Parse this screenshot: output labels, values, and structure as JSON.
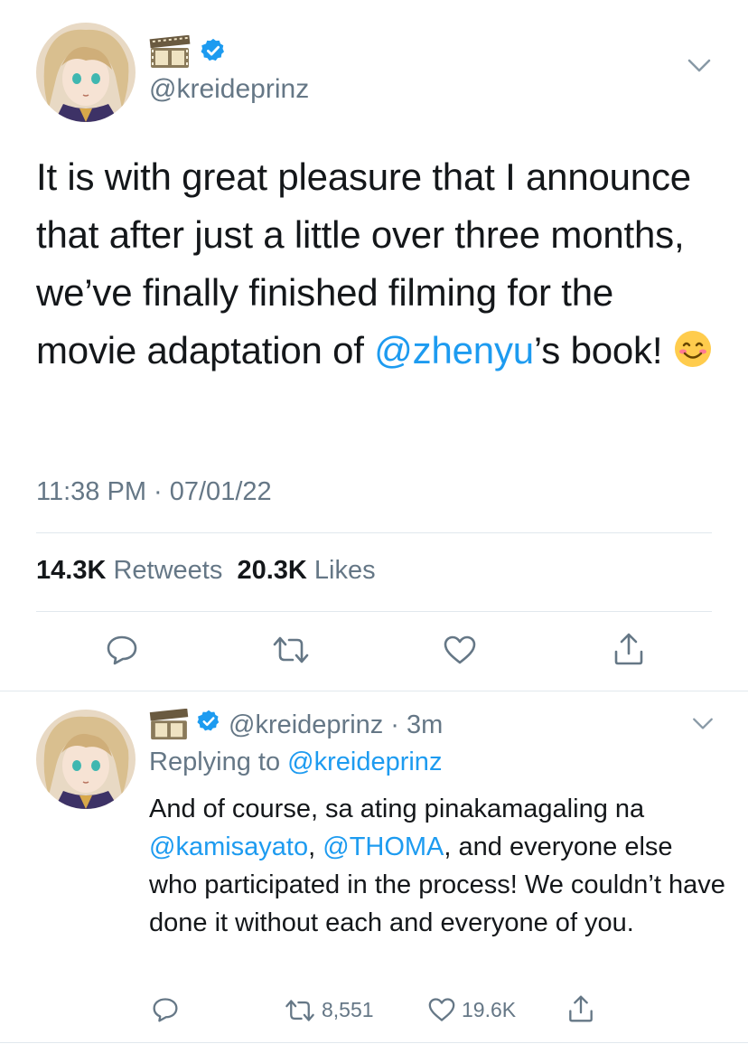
{
  "colors": {
    "link": "#1d9bf0",
    "secondary": "#657786",
    "verified": "#1d9bf0",
    "divider": "#e1e8ed"
  },
  "main_tweet": {
    "handle": "@kreideprinz",
    "name_icon": "film-strip-icon",
    "verified": true,
    "text_parts": [
      "It is with great pleasure that I announce that after just a little over three months, we’ve finally finished filming for the movie adaptation of ",
      "@zhenyu",
      "’s book! "
    ],
    "emoji": "😊",
    "timestamp": "11:38 PM · 07/01/22",
    "retweets_count": "14.3K",
    "retweets_label": "Retweets",
    "likes_count": "20.3K",
    "likes_label": "Likes",
    "actions": [
      "reply-icon",
      "retweet-icon",
      "like-icon",
      "share-icon"
    ]
  },
  "reply_tweet": {
    "handle": "@kreideprinz",
    "separator": "·",
    "time": "3m",
    "replying_label": "Replying to",
    "replying_handle": "@kreideprinz",
    "text_parts": [
      "And of course, sa ating pinakamagaling na ",
      "@kamisayato",
      ", ",
      "@THOMA",
      ", and everyone else who participated in the process! We couldn’t have done it without each and everyone of you."
    ],
    "retweet_count": "8,551",
    "like_count": "19.6K"
  }
}
